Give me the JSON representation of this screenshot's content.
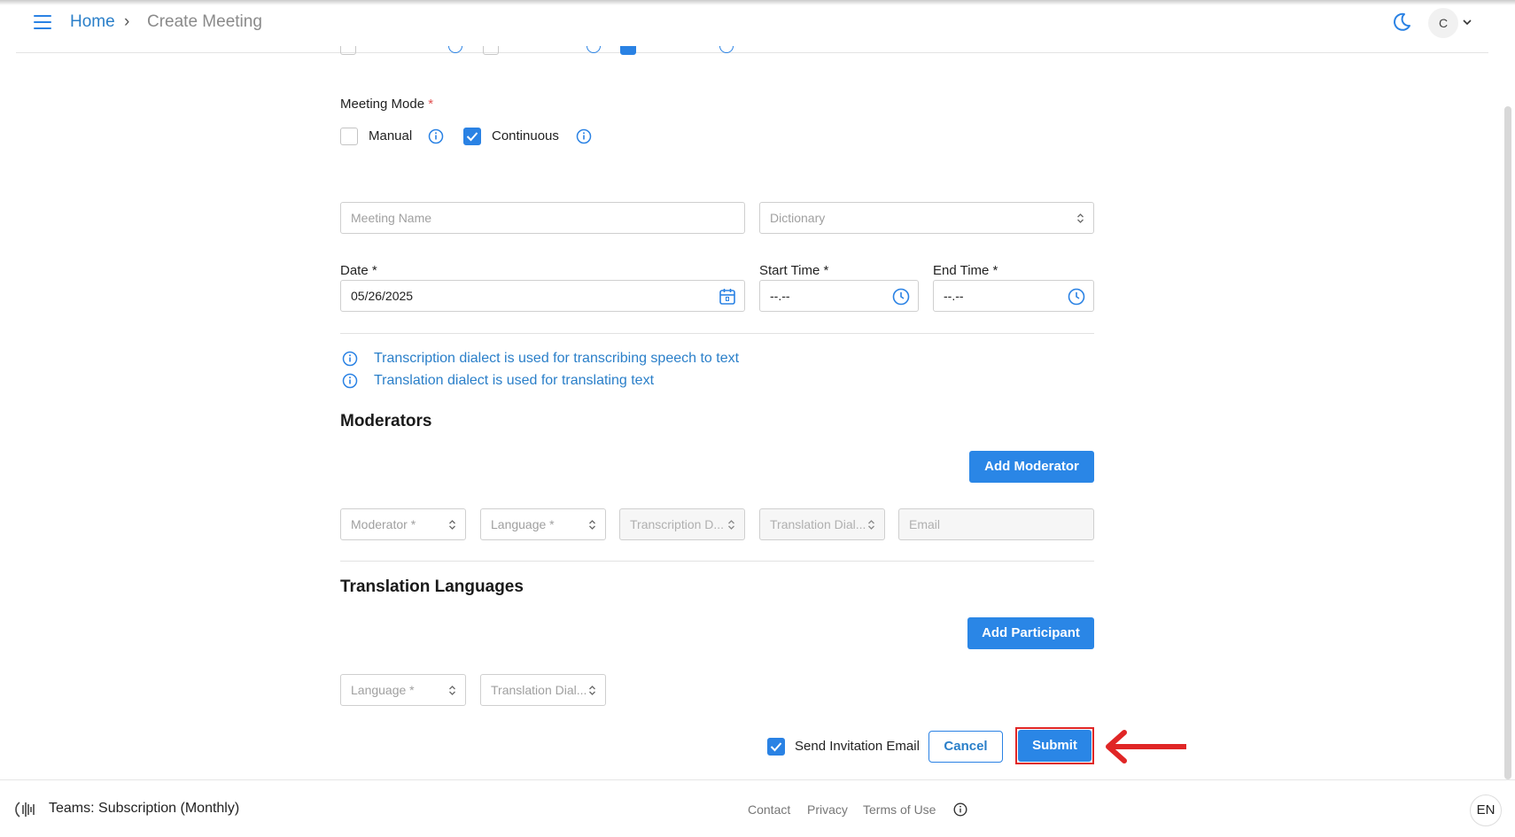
{
  "header": {
    "breadcrumb_home": "Home",
    "breadcrumb_sep": "›",
    "breadcrumb_current": "Create Meeting",
    "avatar_initial": "C"
  },
  "meeting_mode": {
    "label": "Meeting Mode",
    "required_mark": "*",
    "options": [
      {
        "label": "Manual",
        "checked": false
      },
      {
        "label": "Continuous",
        "checked": true
      }
    ]
  },
  "fields": {
    "meeting_name_placeholder": "Meeting Name",
    "dictionary_placeholder": "Dictionary",
    "date_label": "Date *",
    "date_value": "05/26/2025",
    "start_time_label": "Start Time *",
    "start_time_value": "--.--",
    "end_time_label": "End Time *",
    "end_time_value": "--.--"
  },
  "hints": [
    "Transcription dialect is used for transcribing speech to text",
    "Translation dialect is used for translating text"
  ],
  "moderators": {
    "title": "Moderators",
    "add_button": "Add Moderator",
    "row": {
      "moderator": "Moderator *",
      "language": "Language *",
      "transcription": "Transcription D...",
      "translation": "Translation Dial...",
      "email": "Email"
    }
  },
  "translation_languages": {
    "title": "Translation Languages",
    "add_button": "Add Participant",
    "row": {
      "language": "Language *",
      "translation": "Translation Dial..."
    }
  },
  "actions": {
    "send_invitation_label": "Send Invitation Email",
    "send_invitation_checked": true,
    "cancel": "Cancel",
    "submit": "Submit"
  },
  "footer": {
    "team": "Teams: Subscription (Monthly)",
    "links": [
      "Contact",
      "Privacy",
      "Terms of Use"
    ],
    "language": "EN"
  },
  "colors": {
    "accent": "#2a86e6",
    "link": "#2a7fc9",
    "highlight": "#e02626"
  }
}
